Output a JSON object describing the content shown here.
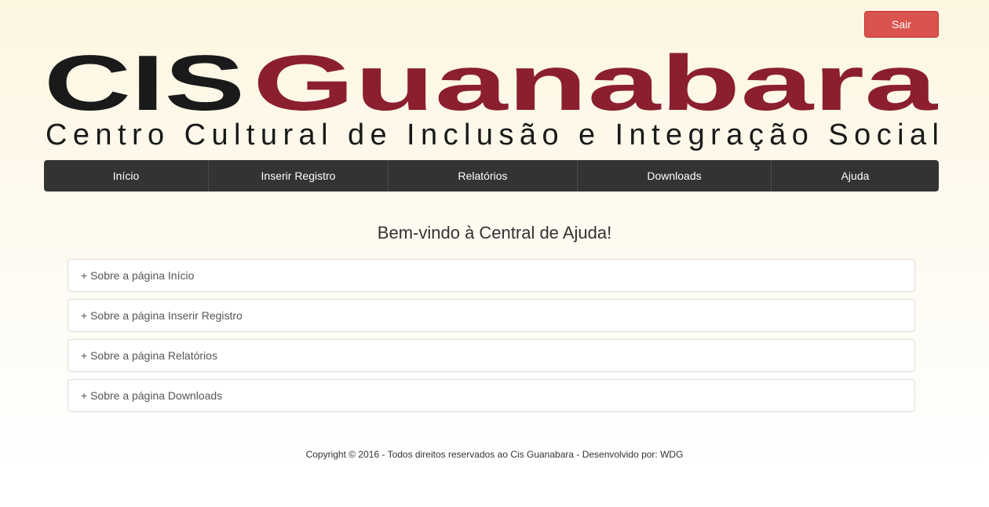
{
  "header": {
    "logout_label": "Sair",
    "logo": {
      "cis": "CIS",
      "guanabara": "Guanabara",
      "subtitle": "Centro Cultural de Inclusão e Integração Social"
    }
  },
  "nav": {
    "items": [
      {
        "label": "Início"
      },
      {
        "label": "Inserir Registro"
      },
      {
        "label": "Relatórios"
      },
      {
        "label": "Downloads"
      },
      {
        "label": "Ajuda"
      }
    ]
  },
  "main": {
    "welcome": "Bem-vindo à Central de Ajuda!",
    "panels": [
      {
        "label": "+ Sobre a página Início"
      },
      {
        "label": "+ Sobre a página Inserir Registro"
      },
      {
        "label": "+ Sobre a página Relatórios"
      },
      {
        "label": "+ Sobre a página Downloads"
      }
    ]
  },
  "footer": {
    "text": "Copyright © 2016 - Todos direitos reservados ao Cis Guanabara - Desenvolvido por: WDG"
  },
  "colors": {
    "logo_dark": "#1a1a1a",
    "logo_accent": "#8b1f2f",
    "nav_bg": "#333333",
    "logout_bg": "#d9534f"
  }
}
